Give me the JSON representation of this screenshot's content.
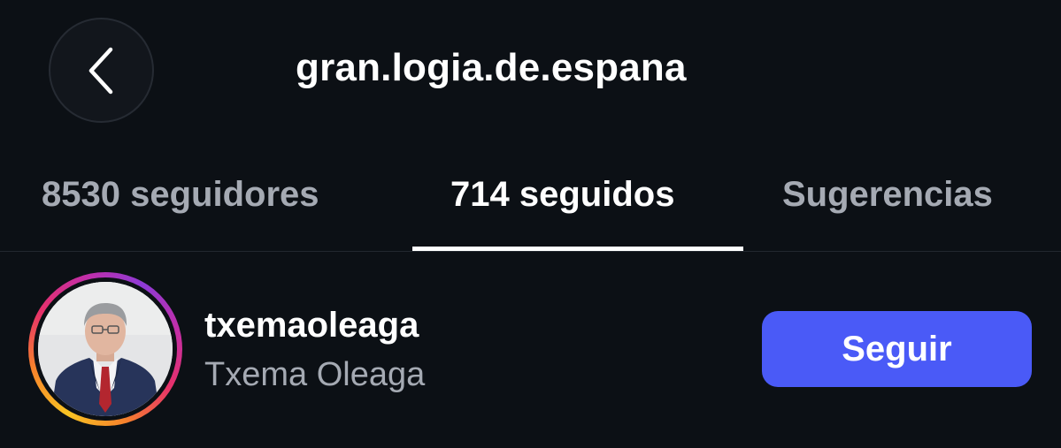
{
  "header": {
    "back_icon": "chevron-left-icon",
    "title": "gran.logia.de.espana"
  },
  "tabs": [
    {
      "label": "8530 seguidores",
      "active": false
    },
    {
      "label": "714 seguidos",
      "active": true
    },
    {
      "label": "Sugerencias",
      "active": false
    }
  ],
  "list": {
    "items": [
      {
        "username": "txemaoleaga",
        "full_name": "Txema Oleaga",
        "action_label": "Seguir",
        "has_story_ring": true
      }
    ]
  },
  "colors": {
    "background": "#0c1015",
    "accent_button": "#4a5af7",
    "text_primary": "#ffffff",
    "text_secondary": "#a5aab3"
  }
}
